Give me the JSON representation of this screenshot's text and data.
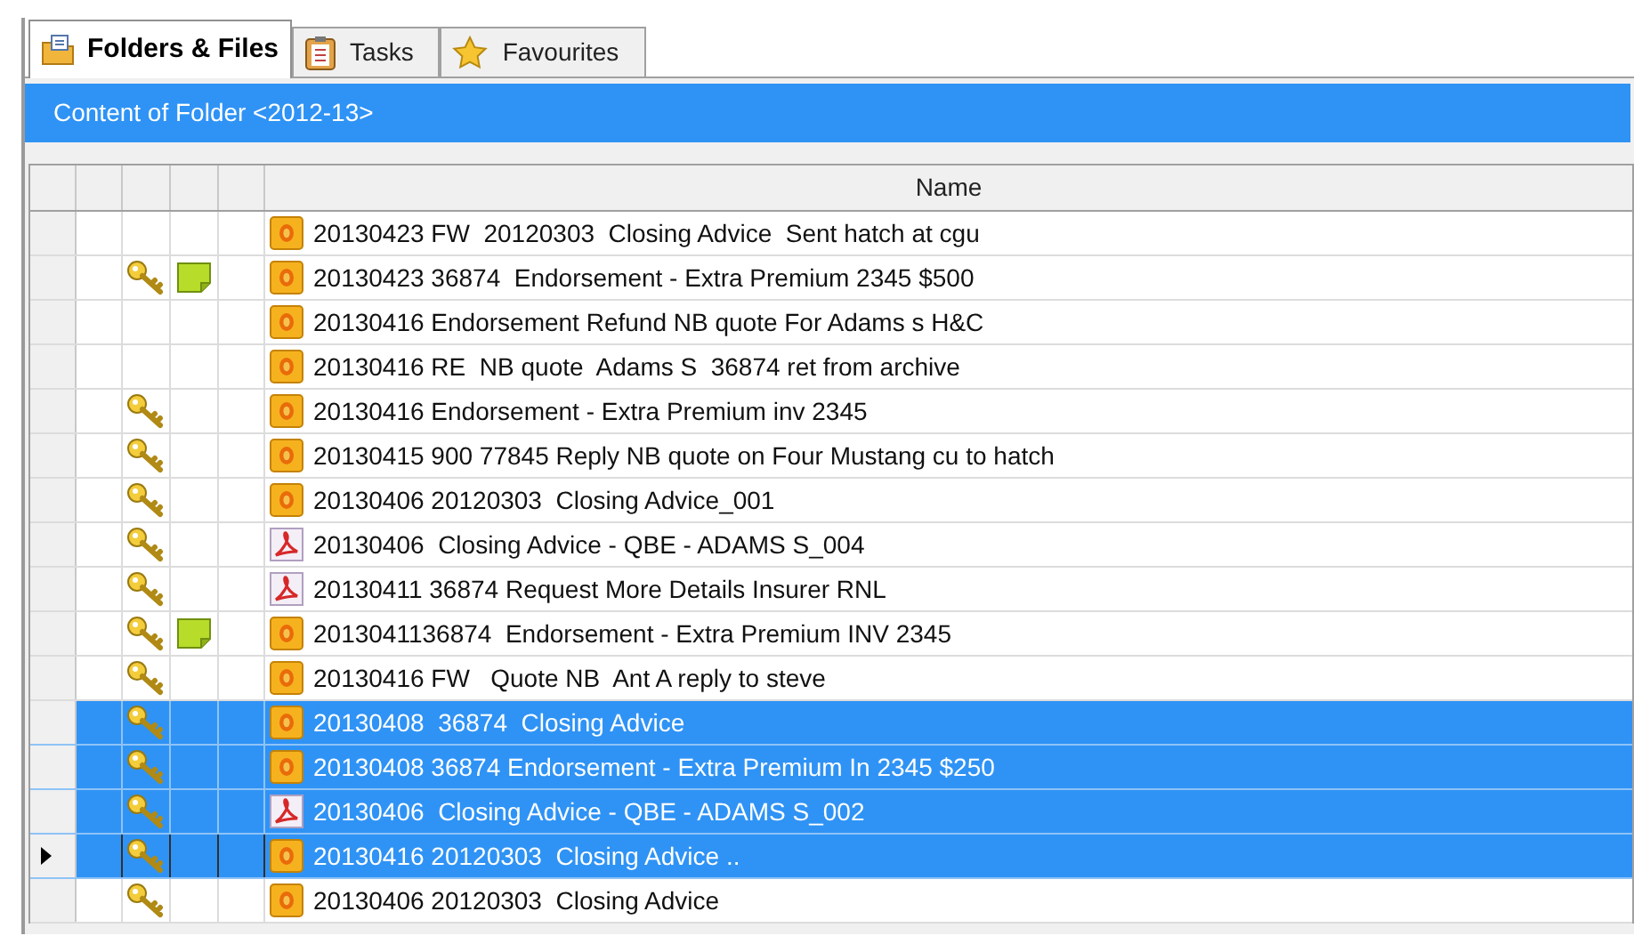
{
  "tabs": [
    {
      "label": "Folders & Files",
      "selected": true
    },
    {
      "label": "Tasks",
      "selected": false
    },
    {
      "label": "Favourites",
      "selected": false
    }
  ],
  "folder_header": "Content of Folder <2012-13>",
  "table": {
    "columns": [
      "Name"
    ],
    "rows": [
      {
        "kind": "email",
        "locked": false,
        "note": false,
        "selected": false,
        "current": false,
        "name": "20130423 FW  20120303  Closing Advice  Sent hatch at cgu"
      },
      {
        "kind": "email",
        "locked": true,
        "note": true,
        "selected": false,
        "current": false,
        "name": "20130423 36874  Endorsement - Extra Premium 2345 $500"
      },
      {
        "kind": "email",
        "locked": false,
        "note": false,
        "selected": false,
        "current": false,
        "name": "20130416 Endorsement Refund NB quote For Adams s H&C"
      },
      {
        "kind": "email",
        "locked": false,
        "note": false,
        "selected": false,
        "current": false,
        "name": "20130416 RE  NB quote  Adams S  36874 ret from archive"
      },
      {
        "kind": "email",
        "locked": true,
        "note": false,
        "selected": false,
        "current": false,
        "name": "20130416 Endorsement - Extra Premium inv 2345"
      },
      {
        "kind": "email",
        "locked": true,
        "note": false,
        "selected": false,
        "current": false,
        "name": "20130415 900 77845 Reply NB quote on Four Mustang cu to hatch"
      },
      {
        "kind": "email",
        "locked": true,
        "note": false,
        "selected": false,
        "current": false,
        "name": "20130406 20120303  Closing Advice_001"
      },
      {
        "kind": "pdf",
        "locked": true,
        "note": false,
        "selected": false,
        "current": false,
        "name": "20130406  Closing Advice - QBE - ADAMS S_004"
      },
      {
        "kind": "pdf",
        "locked": true,
        "note": false,
        "selected": false,
        "current": false,
        "name": "20130411 36874 Request More Details Insurer RNL"
      },
      {
        "kind": "email",
        "locked": true,
        "note": true,
        "selected": false,
        "current": false,
        "name": "2013041136874  Endorsement - Extra Premium INV 2345"
      },
      {
        "kind": "email",
        "locked": true,
        "note": false,
        "selected": false,
        "current": false,
        "name": "20130416 FW   Quote NB  Ant A reply to steve"
      },
      {
        "kind": "email",
        "locked": true,
        "note": false,
        "selected": true,
        "current": false,
        "name": "20130408  36874  Closing Advice"
      },
      {
        "kind": "email",
        "locked": true,
        "note": false,
        "selected": true,
        "current": false,
        "name": "20130408 36874 Endorsement - Extra Premium In 2345 $250"
      },
      {
        "kind": "pdf",
        "locked": true,
        "note": false,
        "selected": true,
        "current": false,
        "name": "20130406  Closing Advice - QBE - ADAMS S_002"
      },
      {
        "kind": "email",
        "locked": true,
        "note": false,
        "selected": true,
        "current": true,
        "name": "20130416 20120303  Closing Advice .."
      },
      {
        "kind": "email",
        "locked": true,
        "note": false,
        "selected": false,
        "current": false,
        "name": "20130406 20120303  Closing Advice"
      }
    ]
  }
}
